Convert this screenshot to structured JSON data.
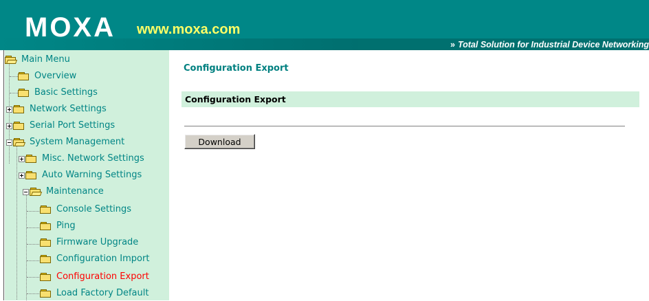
{
  "header": {
    "logo": "MOXA",
    "url": "www.moxa.com",
    "tagline_chevron": "»",
    "tagline": "Total Solution for Industrial Device Networking"
  },
  "sidebar": {
    "items": [
      {
        "label": "Main Menu",
        "type": "open-folder",
        "expander": "none"
      },
      {
        "label": "Overview",
        "type": "folder",
        "expander": "none"
      },
      {
        "label": "Basic Settings",
        "type": "folder",
        "expander": "none"
      },
      {
        "label": "Network Settings",
        "type": "folder",
        "expander": "plus"
      },
      {
        "label": "Serial Port Settings",
        "type": "folder",
        "expander": "plus"
      },
      {
        "label": "System Management",
        "type": "open-folder",
        "expander": "minus"
      },
      {
        "label": "Misc. Network Settings",
        "type": "folder",
        "expander": "plus"
      },
      {
        "label": "Auto Warning Settings",
        "type": "folder",
        "expander": "plus"
      },
      {
        "label": "Maintenance",
        "type": "open-folder",
        "expander": "minus"
      },
      {
        "label": "Console Settings",
        "type": "folder",
        "expander": "none"
      },
      {
        "label": "Ping",
        "type": "folder",
        "expander": "none"
      },
      {
        "label": "Firmware Upgrade",
        "type": "folder",
        "expander": "none"
      },
      {
        "label": "Configuration Import",
        "type": "folder",
        "expander": "none"
      },
      {
        "label": "Configuration Export",
        "type": "folder",
        "expander": "none",
        "active": true
      },
      {
        "label": "Load Factory Default",
        "type": "folder",
        "expander": "none"
      }
    ]
  },
  "main": {
    "page_title": "Configuration Export",
    "section_title": "Configuration Export",
    "download_label": "Download"
  },
  "colors": {
    "header_bg": "#008787",
    "url_text": "#ffff66",
    "sidebar_bg": "#d0f0dc",
    "link_text": "#008585",
    "active_text": "#ff0000",
    "title_text": "#008080"
  }
}
